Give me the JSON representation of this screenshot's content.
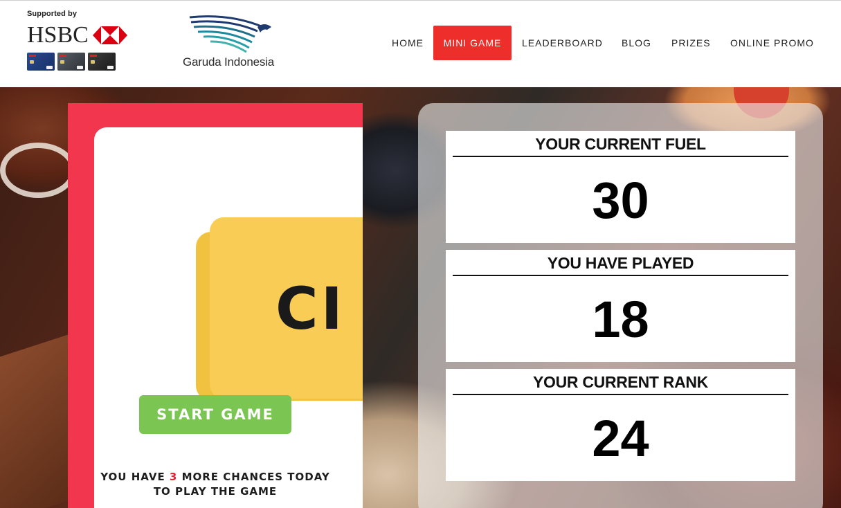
{
  "header": {
    "sponsor_text": "Supported by",
    "sponsor_brand": "HSBC",
    "partner_name": "Garuda Indonesia",
    "nav": [
      {
        "label": "HOME",
        "active": false
      },
      {
        "label": "MINI GAME",
        "active": true
      },
      {
        "label": "LEADERBOARD",
        "active": false
      },
      {
        "label": "BLOG",
        "active": false
      },
      {
        "label": "PRIZES",
        "active": false
      },
      {
        "label": "ONLINE PROMO",
        "active": false
      }
    ],
    "accent_color": "#ee2e2a"
  },
  "game": {
    "tile_text": "CI",
    "start_label": "START GAME",
    "chances_prefix": "YOU HAVE ",
    "chances_count": "3",
    "chances_suffix": " MORE CHANCES TODAY",
    "chances_line2": "TO PLAY THE GAME",
    "panel_color": "#f2364d",
    "button_color": "#7bc652"
  },
  "stats": [
    {
      "title": "YOUR CURRENT FUEL",
      "value": "30"
    },
    {
      "title": "YOU HAVE PLAYED",
      "value": "18"
    },
    {
      "title": "YOUR CURRENT RANK",
      "value": "24"
    }
  ]
}
